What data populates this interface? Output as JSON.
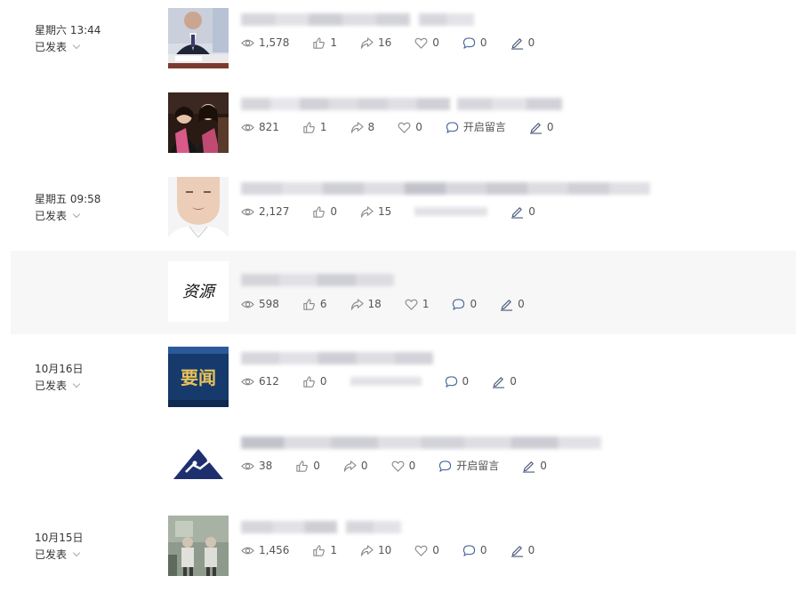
{
  "rows": [
    {
      "date": "星期六 13:44",
      "status": "已发表",
      "thumb": "photo-man-at-desk",
      "stats": {
        "read": "1,578",
        "like": "1",
        "share": "16",
        "fav": "0",
        "comment": "0",
        "edit": "0"
      }
    },
    {
      "date": "",
      "status": "",
      "thumb": "photo-graduates",
      "stats": {
        "read": "821",
        "like": "1",
        "share": "8",
        "fav": "0",
        "comment": "开启留言",
        "edit": "0"
      }
    },
    {
      "date": "星期五 09:58",
      "status": "已发表",
      "thumb": "photo-portrait",
      "stats": {
        "read": "2,127",
        "like": "0",
        "share": "15",
        "fav": "",
        "comment": "",
        "edit": "0"
      }
    },
    {
      "date": "",
      "status": "",
      "thumb": "calligraphy-资源",
      "thumb_text": "资源",
      "stats": {
        "read": "598",
        "like": "6",
        "share": "18",
        "fav": "1",
        "comment": "0",
        "edit": "0"
      }
    },
    {
      "date": "10月16日",
      "status": "已发表",
      "thumb": "banner-要闻",
      "thumb_text": "要闻",
      "stats": {
        "read": "612",
        "like": "0",
        "share": "",
        "fav": "",
        "comment": "0",
        "edit": "0"
      }
    },
    {
      "date": "",
      "status": "",
      "thumb": "logo-triangle",
      "stats": {
        "read": "38",
        "like": "0",
        "share": "0",
        "fav": "0",
        "comment": "开启留言",
        "edit": "0"
      }
    },
    {
      "date": "10月15日",
      "status": "已发表",
      "thumb": "photo-workers",
      "stats": {
        "read": "1,456",
        "like": "1",
        "share": "10",
        "fav": "0",
        "comment": "0",
        "edit": "0"
      }
    }
  ],
  "colors": {
    "hover_bg": "#f7f7f8",
    "icon": "#8a8a8a",
    "text": "#353535",
    "blur": "#c8c8d0",
    "yaowen_bg": "#163a6b",
    "yaowen_text": "#e8c25a",
    "triangle": "#1e2f6e"
  }
}
